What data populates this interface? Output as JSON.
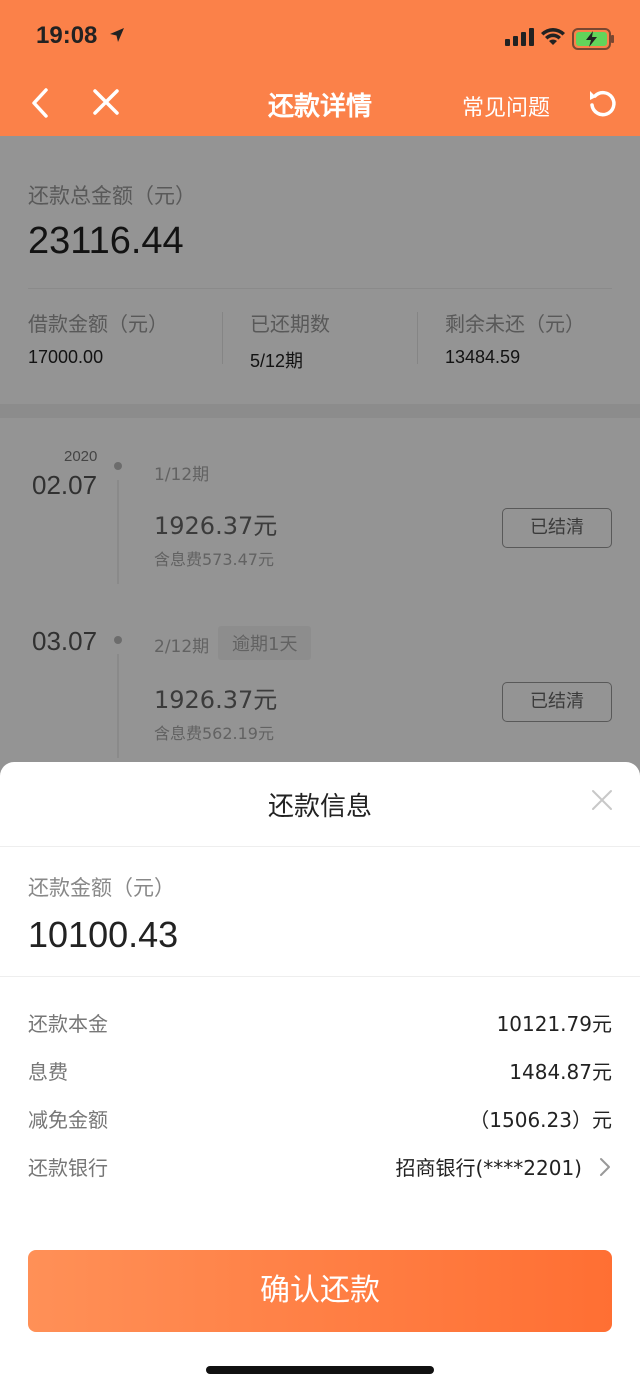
{
  "status_bar": {
    "time": "19:08"
  },
  "nav": {
    "title": "还款详情",
    "faq_label": "常见问题"
  },
  "summary": {
    "total_label": "还款总金额（元）",
    "total_value": "23116.44",
    "stats": [
      {
        "label": "借款金额（元）",
        "value": "17000.00"
      },
      {
        "label": "已还期数",
        "value": "5/12期"
      },
      {
        "label": "剩余未还（元）",
        "value": "13484.59"
      }
    ]
  },
  "timeline": [
    {
      "year": "2020",
      "date": "02.07",
      "period": "1/12期",
      "badge": "",
      "amount": "1926.37元",
      "fee": "含息费573.47元",
      "button": "已结清"
    },
    {
      "year": "",
      "date": "03.07",
      "period": "2/12期",
      "badge": "逾期1天",
      "amount": "1926.37元",
      "fee": "含息费562.19元",
      "button": "已结清"
    }
  ],
  "sheet": {
    "title": "还款信息",
    "amount_label": "还款金额（元）",
    "amount_value": "10100.43",
    "rows": [
      {
        "key": "还款本金",
        "value": "10121.79元"
      },
      {
        "key": "息费",
        "value": "1484.87元"
      },
      {
        "key": "减免金额",
        "value": "（1506.23）元"
      },
      {
        "key": "还款银行",
        "value": "招商银行(****2201)"
      }
    ],
    "confirm_label": "确认还款"
  },
  "colors": {
    "brand": "#fb8149",
    "button_start": "#ff9057",
    "button_end": "#ff6f33"
  },
  "icons": [
    "location-arrow-icon",
    "signal-icon",
    "wifi-icon",
    "battery-charging-icon",
    "back-icon",
    "close-icon",
    "refresh-icon",
    "chevron-right-icon"
  ]
}
